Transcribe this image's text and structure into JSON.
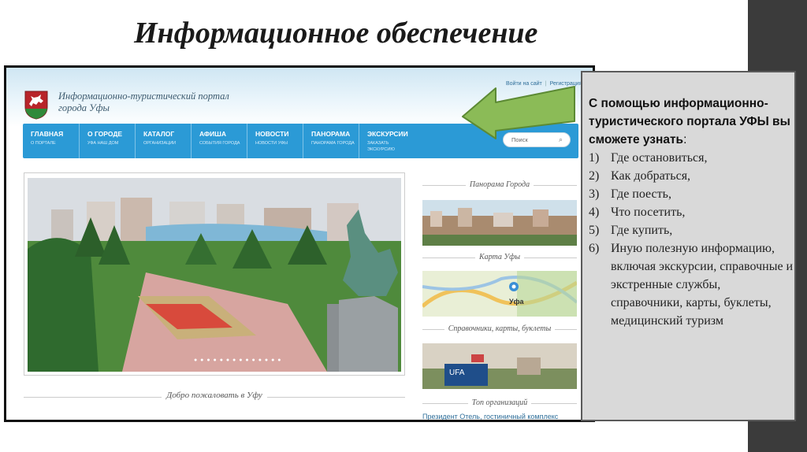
{
  "slide": {
    "title": "Информационное обеспечение"
  },
  "portal": {
    "title": "Информационно-туристический портал города Уфы",
    "top_links": [
      "Войти на сайт",
      "Регистрация"
    ],
    "nav": [
      {
        "label": "ГЛАВНАЯ",
        "sub": "О ПОРТАЛЕ"
      },
      {
        "label": "О ГОРОДЕ",
        "sub": "УФА НАШ ДОМ"
      },
      {
        "label": "КАТАЛОГ",
        "sub": "ОРГАНИЗАЦИИ"
      },
      {
        "label": "АФИША",
        "sub": "СОБЫТИЯ ГОРОДА"
      },
      {
        "label": "НОВОСТИ",
        "sub": "НОВОСТИ УФЫ"
      },
      {
        "label": "ПАНОРАМА",
        "sub": "ПАНОРАМА ГОРОДА"
      },
      {
        "label": "ЭКСКУРСИИ",
        "sub": "ЗАКАЗАТЬ ЭКСКУРСИЮ"
      }
    ],
    "search_placeholder": "Поиск",
    "welcome": "Добро пожаловать в Уфу",
    "sidebar": {
      "panorama": "Панорама Города",
      "map": "Карта Уфы",
      "guides": "Справочники, карты, буклеты",
      "top_orgs": "Топ организаций",
      "top_org_item": "Президент Отель, гостиничный комплекс"
    },
    "map_label": "Уфа",
    "guide_banner": "UFA"
  },
  "info": {
    "lead": "С помощью информационно-туристического портала УФЫ вы сможете узнать",
    "lead_suffix": ":",
    "items": [
      {
        "num": "1)",
        "text": "Где остановиться,"
      },
      {
        "num": "2)",
        "text": "Как добраться,"
      },
      {
        "num": "3)",
        "text": "Где поесть,"
      },
      {
        "num": "4)",
        "text": "Что посетить,"
      },
      {
        "num": "5)",
        "text": "Где купить,"
      },
      {
        "num": "6)",
        "text": "Иную полезную информацию, включая экскурсии, справочные и экстренные службы, справочники, карты, буклеты, медицинский туризм"
      }
    ]
  },
  "colors": {
    "nav_blue": "#2b9ad6",
    "arrow_green": "#8bbb57",
    "panel_gray": "#d9d9d9",
    "band_dark": "#3b3b3b"
  }
}
